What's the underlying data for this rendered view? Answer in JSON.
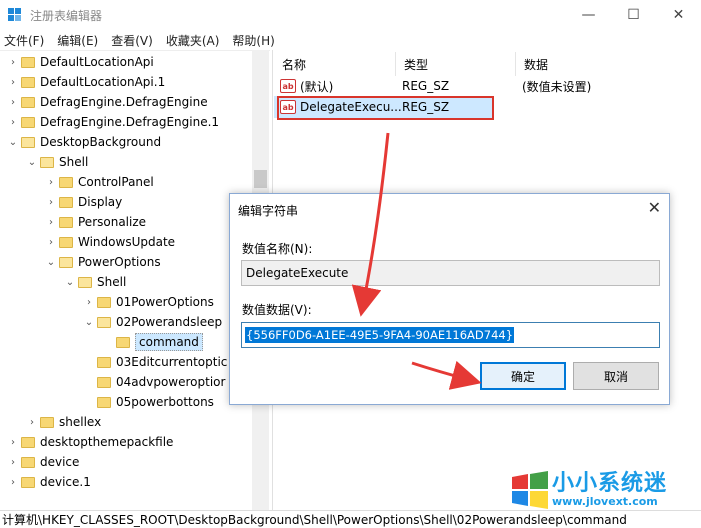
{
  "window": {
    "title": "注册表编辑器",
    "minimize": "—",
    "maximize": "☐",
    "close": "✕"
  },
  "menu": [
    "文件(F)",
    "编辑(E)",
    "查看(V)",
    "收藏夹(A)",
    "帮助(H)"
  ],
  "tree": [
    {
      "label": "DefaultLocationApi",
      "indent": 0,
      "chev": "›"
    },
    {
      "label": "DefaultLocationApi.1",
      "indent": 0,
      "chev": "›"
    },
    {
      "label": "DefragEngine.DefragEngine",
      "indent": 0,
      "chev": "›"
    },
    {
      "label": "DefragEngine.DefragEngine.1",
      "indent": 0,
      "chev": "›"
    },
    {
      "label": "DesktopBackground",
      "indent": 0,
      "chev": "⌄",
      "open": true
    },
    {
      "label": "Shell",
      "indent": 1,
      "chev": "⌄",
      "open": true
    },
    {
      "label": "ControlPanel",
      "indent": 2,
      "chev": "›"
    },
    {
      "label": "Display",
      "indent": 2,
      "chev": "›"
    },
    {
      "label": "Personalize",
      "indent": 2,
      "chev": "›"
    },
    {
      "label": "WindowsUpdate",
      "indent": 2,
      "chev": "›"
    },
    {
      "label": "PowerOptions",
      "indent": 2,
      "chev": "⌄",
      "open": true
    },
    {
      "label": "Shell",
      "indent": 3,
      "chev": "⌄",
      "open": true
    },
    {
      "label": "01PowerOptions",
      "indent": 4,
      "chev": "›"
    },
    {
      "label": "02Powerandsleep",
      "indent": 4,
      "chev": "⌄",
      "open": true
    },
    {
      "label": "command",
      "indent": 5,
      "chev": "",
      "selected": true
    },
    {
      "label": "03Editcurrentoptic",
      "indent": 4,
      "chev": ""
    },
    {
      "label": "04advpoweroptior",
      "indent": 4,
      "chev": ""
    },
    {
      "label": "05powerbottons",
      "indent": 4,
      "chev": ""
    },
    {
      "label": "shellex",
      "indent": 1,
      "chev": "›"
    },
    {
      "label": "desktopthemepackfile",
      "indent": 0,
      "chev": "›"
    },
    {
      "label": "device",
      "indent": 0,
      "chev": "›"
    },
    {
      "label": "device.1",
      "indent": 0,
      "chev": "›"
    }
  ],
  "list": {
    "headers": [
      "名称",
      "类型",
      "数据"
    ],
    "rows": [
      {
        "name": "(默认)",
        "type": "REG_SZ",
        "data": "(数值未设置)"
      },
      {
        "name": "DelegateExecu...",
        "type": "REG_SZ",
        "data": ""
      }
    ]
  },
  "dialog": {
    "title": "编辑字符串",
    "close": "✕",
    "name_label": "数值名称(N):",
    "name_value": "DelegateExecute",
    "data_label": "数值数据(V):",
    "data_value": "{556FF0D6-A1EE-49E5-9FA4-90AE116AD744}",
    "ok": "确定",
    "cancel": "取消"
  },
  "status": "计算机\\HKEY_CLASSES_ROOT\\DesktopBackground\\Shell\\PowerOptions\\Shell\\02Powerandsleep\\command",
  "watermark": {
    "text": "小小系统迷",
    "url": "www.jlovext.com"
  },
  "colors": {
    "accent": "#0078d7",
    "highlight": "#d9352b",
    "selection": "#cde8ff"
  }
}
